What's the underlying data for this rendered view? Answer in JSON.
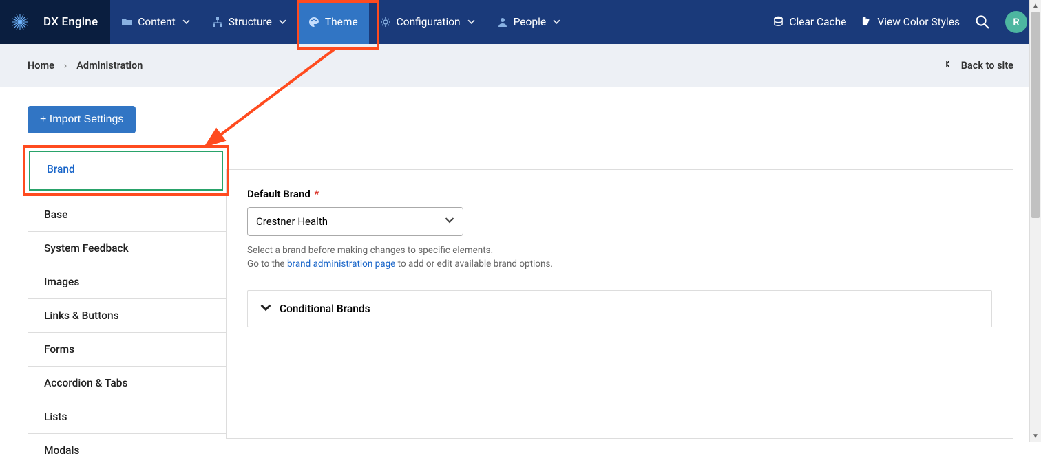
{
  "brand": {
    "name": "DX Engine"
  },
  "nav": {
    "content": "Content",
    "structure": "Structure",
    "theme": "Theme",
    "configuration": "Configuration",
    "people": "People"
  },
  "topbar_right": {
    "clear_cache": "Clear Cache",
    "view_styles": "View Color Styles",
    "avatar_initial": "R"
  },
  "breadcrumb": {
    "home": "Home",
    "current": "Administration",
    "back": "Back to site"
  },
  "actions": {
    "import": "+ Import Settings"
  },
  "tabs": [
    "Brand",
    "Base",
    "System Feedback",
    "Images",
    "Links & Buttons",
    "Forms",
    "Accordion & Tabs",
    "Lists",
    "Modals"
  ],
  "form": {
    "default_brand_label": "Default Brand",
    "default_brand_value": "Crestner Health",
    "help_line1": "Select a brand before making changes to specific elements.",
    "help_prefix": "Go to the ",
    "help_link": "brand administration page",
    "help_suffix": " to add or edit available brand options.",
    "conditional_heading": "Conditional Brands"
  }
}
